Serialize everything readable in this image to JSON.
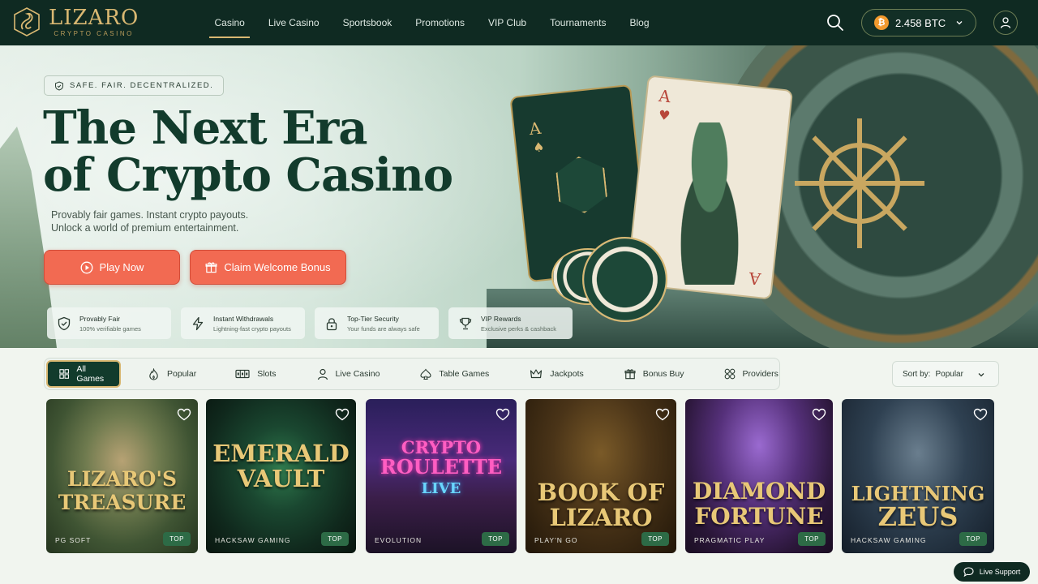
{
  "brand": {
    "name": "LIZARO",
    "tagline": "CRYPTO CASINO"
  },
  "nav": [
    {
      "label": "Casino",
      "active": true
    },
    {
      "label": "Live Casino"
    },
    {
      "label": "Sportsbook"
    },
    {
      "label": "Promotions"
    },
    {
      "label": "VIP Club"
    },
    {
      "label": "Tournaments"
    },
    {
      "label": "Blog"
    }
  ],
  "wallet": {
    "balance": "2.458 BTC",
    "coin_symbol": "₿"
  },
  "hero": {
    "badge": "SAFE. FAIR. DECENTRALIZED.",
    "title_line1": "The Next Era",
    "title_line2": "of Crypto Casino",
    "subtitle_line1": "Provably fair games. Instant crypto payouts.",
    "subtitle_line2": "Unlock a world of premium entertainment.",
    "play_label": "Play Now",
    "bonus_label": "Claim Welcome Bonus"
  },
  "features": [
    {
      "title": "Provably Fair",
      "desc": "100% verifiable games",
      "icon": "shield-check-icon"
    },
    {
      "title": "Instant Withdrawals",
      "desc": "Lightning-fast crypto payouts",
      "icon": "lightning-icon"
    },
    {
      "title": "Top-Tier Security",
      "desc": "Your funds are always safe",
      "icon": "lock-icon"
    },
    {
      "title": "VIP Rewards",
      "desc": "Exclusive perks & cashback",
      "icon": "trophy-icon"
    }
  ],
  "filters": [
    {
      "label": "All Games",
      "icon": "grid-icon",
      "active": true
    },
    {
      "label": "Popular",
      "icon": "flame-icon"
    },
    {
      "label": "Slots",
      "icon": "slot-machine-icon"
    },
    {
      "label": "Live Casino",
      "icon": "person-icon"
    },
    {
      "label": "Table Games",
      "icon": "spade-icon"
    },
    {
      "label": "Jackpots",
      "icon": "crown-icon"
    },
    {
      "label": "Bonus Buy",
      "icon": "gift-icon"
    },
    {
      "label": "Providers",
      "icon": "providers-icon"
    }
  ],
  "sort": {
    "label": "Sort by:",
    "value": "Popular"
  },
  "games": [
    {
      "title_line1": "LIZARO'S",
      "title_line2": "TREASURE",
      "provider": "PG SOFT",
      "badge": "TOP"
    },
    {
      "title_line1": "EMERALD",
      "title_line2": "VAULT",
      "provider": "HACKSAW GAMING",
      "badge": "TOP"
    },
    {
      "title_line1": "CRYPTO",
      "title_line2": "ROULETTE",
      "title_line3": "LIVE",
      "provider": "EVOLUTION",
      "badge": "TOP"
    },
    {
      "title_line1": "BOOK OF",
      "title_line2": "LIZARO",
      "provider": "PLAY'N GO",
      "badge": "TOP"
    },
    {
      "title_line1": "DIAMOND",
      "title_line2": "FORTUNE",
      "provider": "PRAGMATIC PLAY",
      "badge": "TOP"
    },
    {
      "title_line1": "LIGHTNING",
      "title_line2": "ZEUS",
      "provider": "HACKSAW GAMING",
      "badge": "TOP"
    }
  ],
  "support": {
    "label": "Live Support"
  },
  "colors": {
    "header_bg": "#0f2a22",
    "gold": "#d9b872",
    "cta": "#f26a52",
    "dark_green": "#123b2c"
  }
}
